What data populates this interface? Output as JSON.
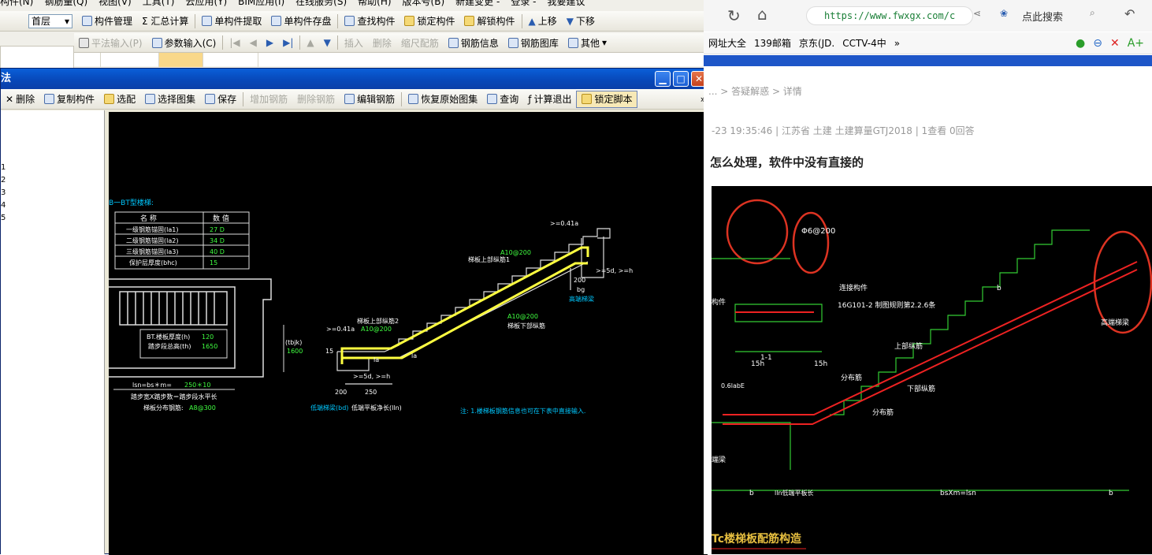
{
  "app": {
    "menu": [
      "构件(N)",
      "钢筋量(Q)",
      "视图(V)",
      "工具(T)",
      "云应用(Y)",
      "BIM应用(I)",
      "在线服务(S)",
      "帮助(H)",
      "版本号(B)",
      "新建变更 -",
      "登录 -",
      "我要建议"
    ],
    "floor": "首层",
    "toolbar1": [
      "构件管理",
      "Σ 汇总计算",
      "单构件提取",
      "单构件存盘",
      "查找构件",
      "锁定构件",
      "解锁构件",
      "上移",
      "下移"
    ],
    "toolbar2": [
      "平法输入(P)",
      "参数输入(C)",
      "插入",
      "删除",
      "缩尺配筋",
      "钢筋信息",
      "钢筋图库",
      "其他"
    ]
  },
  "dialog": {
    "title": "法",
    "tools": [
      "删除",
      "复制构件",
      "选配",
      "选择图集",
      "保存",
      "增加钢筋",
      "删除钢筋",
      "编辑钢筋",
      "恢复原始图集",
      "查询",
      "计算退出",
      "锁定脚本"
    ],
    "left_numbers": [
      "1",
      "2",
      "3",
      "4",
      "5"
    ],
    "cad": {
      "heading": "B一BT型楼梯:",
      "table_header": [
        "名 称",
        "数 值"
      ],
      "table_rows": [
        [
          "一级钢筋锚固(la1)",
          "27 D"
        ],
        [
          "二级钢筋锚固(la2)",
          "34 D"
        ],
        [
          "三级钢筋锚固(la3)",
          "40 D"
        ],
        [
          "保护层厚度(bhc)",
          "15"
        ]
      ],
      "bt_label": "BT.楼板厚度(h)",
      "bt_value": "120",
      "step_label": "踏步段总高(th)",
      "step_value": "1650",
      "tbjk": "(tbjk)",
      "tbjk_value": "1600",
      "lsn": "lsn=bs＊m=",
      "lsn_value": "250＊10",
      "step_width": "踏步宽X踏步数＝踏步段水平长",
      "dist_label": "梯板分布钢筋:",
      "dist_value": "A8@300",
      "upper1": "梯板上部纵筋1",
      "upper1_spec": "A10@200",
      "upper2": "梯板上部纵筋2",
      "upper2_spec": "A10@200",
      "lower": "梯板下部纵筋",
      "lower_spec": "A10@200",
      "high_beam": "高端梯梁",
      "low_beam": "低端梯梁(bd)",
      "low_flat": "低端平板净长(lln)",
      "dim_200a": "200",
      "dim_250": "250",
      "dim_200b": "200",
      "bg": "bg",
      "la1": ">=0.41a",
      "la2": ">=0.41a",
      "d5a": ">=5d, >=h",
      "d5b": ">=5d, >=h",
      "la": "la",
      "la_b": "la",
      "fifteen": "15",
      "note": "注: 1.楼梯板钢筋信息也可在下表中直接输入."
    }
  },
  "browser": {
    "url": "https://www.fwxgx.com/c",
    "search": "点此搜索",
    "bookmarks": [
      "网址大全",
      "139邮箱",
      "京东(JD.",
      "CCTV-4中",
      "»"
    ],
    "breadcrumb": "... > 答疑解惑 > 详情",
    "meta": "-23 19:35:46    |    江苏省  土建 土建算量GTJ2018    |    1查看  0回答",
    "question": "怎么处理，软件中没有直接的",
    "cad": {
      "spec_a": "Φ6@200",
      "lianjie": "连接构件",
      "atlas": "16G101-2 制图规则第2.2.6条",
      "sec": "1-1",
      "h15a": "15h",
      "h15b": "15h",
      "top_bar": "上部纵筋",
      "dist1": "分布筋",
      "dist2": "分布筋",
      "low_bar": "下部纵筋",
      "high_beam": "高端梯梁",
      "low_beam": "端梁",
      "member": "构件",
      "b1": "b",
      "b2": "b",
      "b3": "b",
      "lln": "lln低端平板长",
      "bsxm": "bsXm=lsn",
      "ratio": "0.6labE",
      "caption": "Tc楼梯板配筋构造"
    }
  }
}
